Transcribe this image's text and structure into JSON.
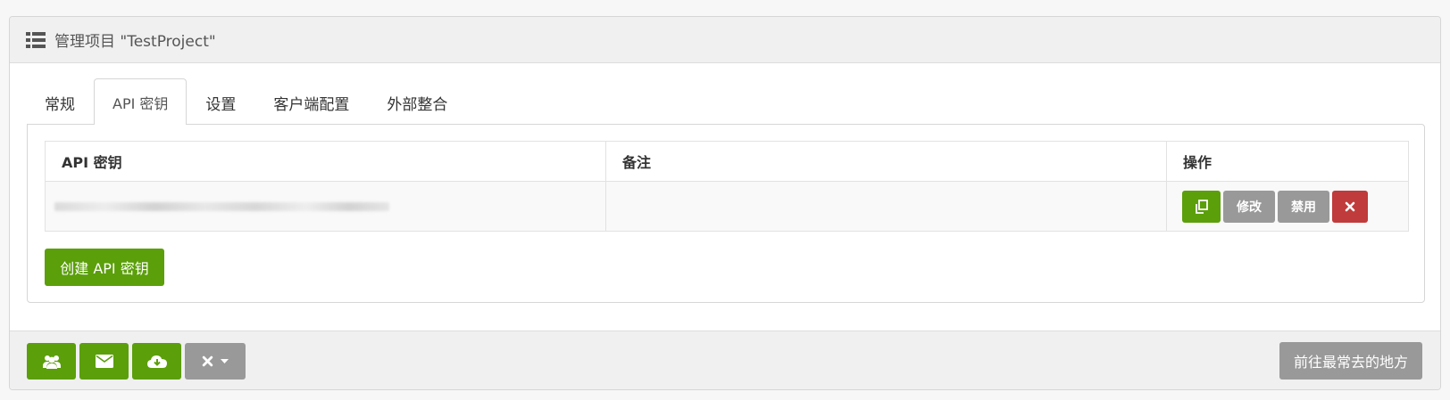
{
  "header": {
    "title": "管理项目 \"TestProject\"",
    "icon": "list-icon"
  },
  "tabs": [
    {
      "label": "常规",
      "active": false
    },
    {
      "label": "API 密钥",
      "active": true
    },
    {
      "label": "设置",
      "active": false
    },
    {
      "label": "客户端配置",
      "active": false
    },
    {
      "label": "外部整合",
      "active": false
    }
  ],
  "table": {
    "headers": [
      "API 密钥",
      "备注",
      "操作"
    ],
    "rows": [
      {
        "note": "",
        "actions": {
          "copy_icon": "copy-icon",
          "edit_label": "修改",
          "disable_label": "禁用",
          "delete_icon": "close-icon"
        }
      }
    ]
  },
  "create_button": {
    "label": "创建 API 密钥"
  },
  "footer": {
    "buttons": [
      {
        "icon": "users-icon"
      },
      {
        "icon": "envelope-icon"
      },
      {
        "icon": "cloud-download-icon"
      },
      {
        "icon": "close-icon",
        "dropdown": "chevron-down-icon"
      }
    ],
    "right_button_label": "前往最常去的地方"
  },
  "colors": {
    "green": "#5b9f0a",
    "gray": "#999999",
    "red": "#c03b3b"
  }
}
